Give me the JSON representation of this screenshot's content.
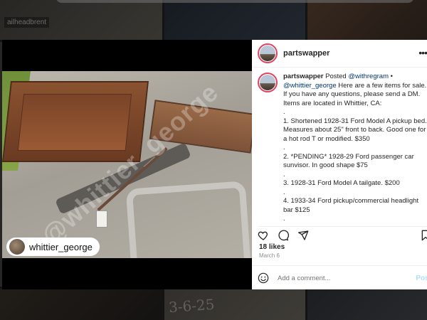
{
  "background": {
    "tile_tag": "ailheadbrent",
    "handwritten_note": "3-6-25"
  },
  "post": {
    "username": "partswapper",
    "credit_username": "whittier_george",
    "watermark_text": "@whittier_george",
    "caption": {
      "username": "partswapper",
      "lines": [
        {
          "pre": " Posted ",
          "mention": "@withregram",
          "post": " •"
        },
        {
          "pre": "",
          "mention": "@whittier_george",
          "post": " Here are a few items for sale."
        },
        {
          "pre": "If you have any questions, please send a DM.",
          "mention": "",
          "post": ""
        },
        {
          "pre": "Items are located in Whittier, CA:",
          "mention": "",
          "post": ""
        },
        {
          "pre": ".",
          "mention": "",
          "post": ""
        },
        {
          "pre": "1. Shortened 1928-31 Ford Model A pickup bed.",
          "mention": "",
          "post": ""
        },
        {
          "pre": "Measures about 25\" front to back. Good one for",
          "mention": "",
          "post": ""
        },
        {
          "pre": "a hot rod T or modified. $350",
          "mention": "",
          "post": ""
        },
        {
          "pre": ".",
          "mention": "",
          "post": ""
        },
        {
          "pre": "2. *PENDING* 1928-29 Ford passenger car",
          "mention": "",
          "post": ""
        },
        {
          "pre": "sunvisor. In good shape $75",
          "mention": "",
          "post": ""
        },
        {
          "pre": ".",
          "mention": "",
          "post": ""
        },
        {
          "pre": "3. 1928-31 Ford Model A tailgate. $200",
          "mention": "",
          "post": ""
        },
        {
          "pre": ".",
          "mention": "",
          "post": ""
        },
        {
          "pre": "4. 1933-34 Ford pickup/commercial headlight",
          "mention": "",
          "post": ""
        },
        {
          "pre": "bar $125",
          "mention": "",
          "post": ""
        },
        {
          "pre": ".",
          "mention": "",
          "post": ""
        }
      ]
    },
    "likes": "18 likes",
    "date": "March 6",
    "comment_placeholder": "Add a comment...",
    "post_button": "Post"
  },
  "icons": {
    "more": "more-options-icon",
    "like": "heart-icon",
    "comment": "comment-icon",
    "share": "share-icon",
    "save": "bookmark-icon",
    "emoji": "emoji-icon"
  },
  "colors": {
    "avatar_ring": "#e4405f",
    "mention": "#00376b",
    "post_button": "#b2dffc",
    "muted": "#8e8e8e"
  }
}
